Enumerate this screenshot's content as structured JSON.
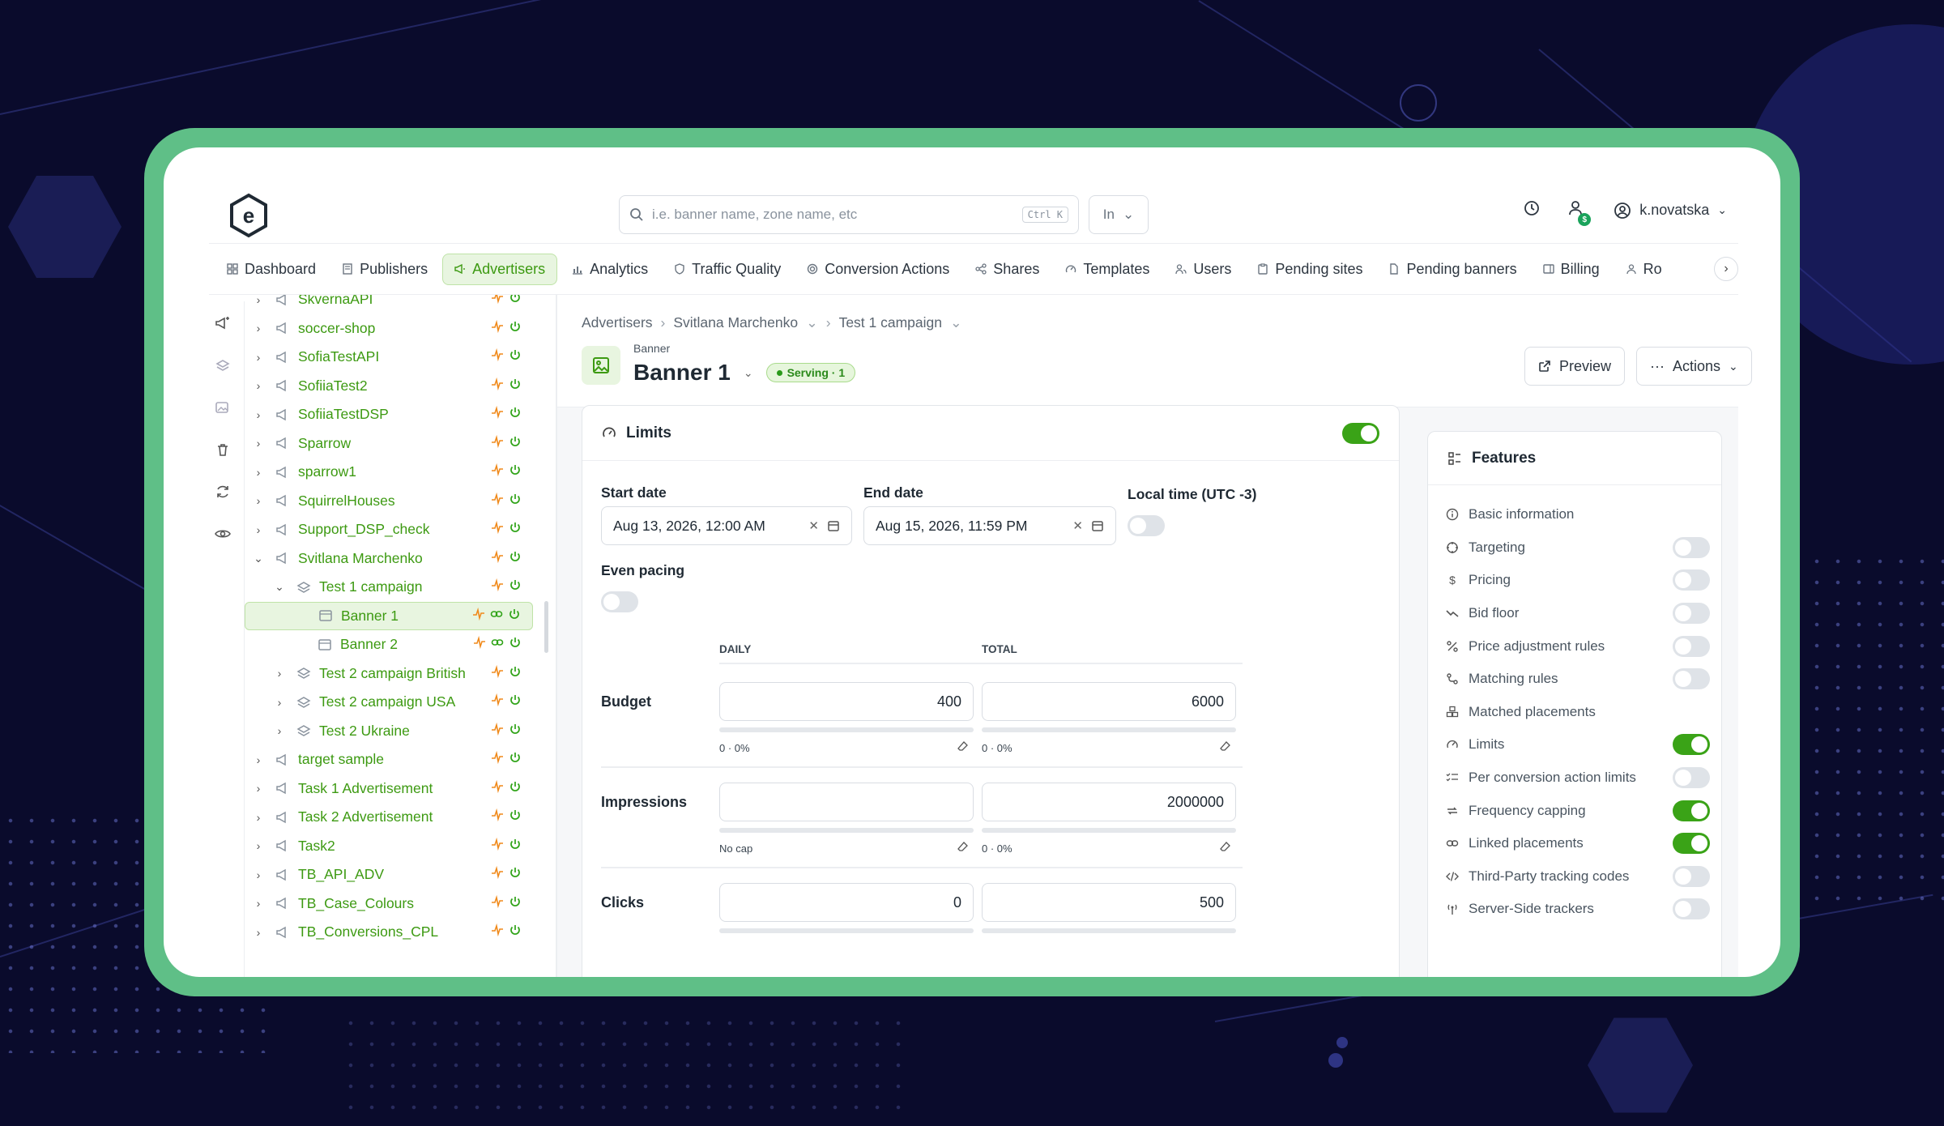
{
  "header": {
    "search_placeholder": "i.e. banner name, zone name, etc",
    "search_shortcut": "Ctrl K",
    "search_scope": "In",
    "username": "k.novatska",
    "badge": "$"
  },
  "nav": {
    "tabs": [
      {
        "label": "Dashboard",
        "icon": "dashboard-icon"
      },
      {
        "label": "Publishers",
        "icon": "publishers-icon"
      },
      {
        "label": "Advertisers",
        "icon": "megaphone-icon",
        "active": true
      },
      {
        "label": "Analytics",
        "icon": "chart-icon"
      },
      {
        "label": "Traffic Quality",
        "icon": "shield-icon"
      },
      {
        "label": "Conversion Actions",
        "icon": "target-icon"
      },
      {
        "label": "Shares",
        "icon": "share-icon"
      },
      {
        "label": "Templates",
        "icon": "gauge-icon"
      },
      {
        "label": "Users",
        "icon": "users-icon"
      },
      {
        "label": "Pending sites",
        "icon": "clipboard-icon"
      },
      {
        "label": "Pending banners",
        "icon": "file-icon"
      },
      {
        "label": "Billing",
        "icon": "billing-icon"
      },
      {
        "label": "Ro",
        "icon": "person-icon"
      }
    ]
  },
  "tree": {
    "rows": [
      {
        "label": "SkvernaAPI",
        "depth": 0,
        "expanded": false,
        "type": "advertiser"
      },
      {
        "label": "soccer-shop",
        "depth": 0,
        "expanded": false,
        "type": "advertiser"
      },
      {
        "label": "SofiaTestAPI",
        "depth": 0,
        "expanded": false,
        "type": "advertiser"
      },
      {
        "label": "SofiiaTest2",
        "depth": 0,
        "expanded": false,
        "type": "advertiser"
      },
      {
        "label": "SofiiaTestDSP",
        "depth": 0,
        "expanded": false,
        "type": "advertiser"
      },
      {
        "label": "Sparrow",
        "depth": 0,
        "expanded": false,
        "type": "advertiser"
      },
      {
        "label": "sparrow1",
        "depth": 0,
        "expanded": false,
        "type": "advertiser"
      },
      {
        "label": "SquirrelHouses",
        "depth": 0,
        "expanded": false,
        "type": "advertiser"
      },
      {
        "label": "Support_DSP_check",
        "depth": 0,
        "expanded": false,
        "type": "advertiser"
      },
      {
        "label": "Svitlana Marchenko",
        "depth": 0,
        "expanded": true,
        "type": "advertiser"
      },
      {
        "label": "Test 1 campaign",
        "depth": 1,
        "expanded": true,
        "type": "campaign"
      },
      {
        "label": "Banner 1",
        "depth": 2,
        "type": "banner",
        "selected": true
      },
      {
        "label": "Banner 2",
        "depth": 2,
        "type": "banner"
      },
      {
        "label": "Test 2 campaign British",
        "depth": 1,
        "expanded": false,
        "type": "campaign"
      },
      {
        "label": "Test 2 campaign USA",
        "depth": 1,
        "expanded": false,
        "type": "campaign"
      },
      {
        "label": "Test 2 Ukraine",
        "depth": 1,
        "expanded": false,
        "type": "campaign"
      },
      {
        "label": "target sample",
        "depth": 0,
        "expanded": false,
        "type": "advertiser"
      },
      {
        "label": "Task 1 Advertisement",
        "depth": 0,
        "expanded": false,
        "type": "advertiser"
      },
      {
        "label": "Task 2 Advertisement",
        "depth": 0,
        "expanded": false,
        "type": "advertiser"
      },
      {
        "label": "Task2",
        "depth": 0,
        "expanded": false,
        "type": "advertiser"
      },
      {
        "label": "TB_API_ADV",
        "depth": 0,
        "expanded": false,
        "type": "advertiser"
      },
      {
        "label": "TB_Case_Colours",
        "depth": 0,
        "expanded": false,
        "type": "advertiser"
      },
      {
        "label": "TB_Conversions_CPL",
        "depth": 0,
        "expanded": false,
        "type": "advertiser"
      }
    ]
  },
  "breadcrumb": {
    "items": [
      "Advertisers",
      "Svitlana Marchenko",
      "Test 1 campaign"
    ]
  },
  "page": {
    "kind": "Banner",
    "title": "Banner 1",
    "status": "Serving · 1",
    "preview_label": "Preview",
    "actions_label": "Actions"
  },
  "limits": {
    "title": "Limits",
    "enabled": true,
    "start_label": "Start date",
    "start_value": "Aug 13, 2026, 12:00 AM",
    "end_label": "End date",
    "end_value": "Aug 15, 2026, 11:59 PM",
    "local_time_label": "Local time (UTC -3)",
    "even_pacing_label": "Even pacing",
    "col_daily": "DAILY",
    "col_total": "TOTAL",
    "rows": [
      {
        "label": "Budget",
        "daily": "400",
        "total": "6000",
        "daily_sub": "0 · 0%",
        "total_sub": "0 · 0%"
      },
      {
        "label": "Impressions",
        "daily": "",
        "total": "2000000",
        "daily_sub": "No cap",
        "total_sub": "0 · 0%"
      },
      {
        "label": "Clicks",
        "daily": "0",
        "total": "500",
        "daily_sub": "",
        "total_sub": ""
      }
    ]
  },
  "features": {
    "title": "Features",
    "items": [
      {
        "label": "Basic information",
        "icon": "info-icon",
        "toggle": null
      },
      {
        "label": "Targeting",
        "icon": "crosshair-icon",
        "toggle": false
      },
      {
        "label": "Pricing",
        "icon": "dollar-icon",
        "toggle": false
      },
      {
        "label": "Bid floor",
        "icon": "trend-down-icon",
        "toggle": false
      },
      {
        "label": "Price adjustment rules",
        "icon": "percent-icon",
        "toggle": false
      },
      {
        "label": "Matching rules",
        "icon": "route-icon",
        "toggle": false
      },
      {
        "label": "Matched placements",
        "icon": "boxes-icon",
        "toggle": null
      },
      {
        "label": "Limits",
        "icon": "gauge-icon",
        "toggle": true
      },
      {
        "label": "Per conversion action limits",
        "icon": "list-check-icon",
        "toggle": false
      },
      {
        "label": "Frequency capping",
        "icon": "repeat-icon",
        "toggle": true
      },
      {
        "label": "Linked placements",
        "icon": "link-icon",
        "toggle": true
      },
      {
        "label": "Third-Party tracking codes",
        "icon": "code-icon",
        "toggle": false
      },
      {
        "label": "Server-Side trackers",
        "icon": "antenna-icon",
        "toggle": false
      }
    ]
  },
  "colors": {
    "accent": "#3d9a12",
    "frame": "#5fbf87",
    "background": "#0a0b2c"
  }
}
